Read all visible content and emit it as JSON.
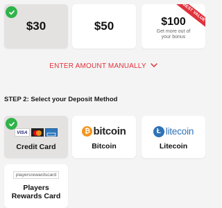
{
  "amounts": [
    {
      "label": "$30",
      "selected": true
    },
    {
      "label": "$50",
      "selected": false
    },
    {
      "label": "$100",
      "note": "Get more out of your bonus",
      "ribbon": "BEST VALUE",
      "selected": false
    }
  ],
  "enter_manually": "ENTER AMOUNT MANUALLY",
  "step2_title": "STEP 2: Select your Deposit Method",
  "methods": [
    {
      "label": "Credit Card",
      "selected": true,
      "logo_text": [
        "VISA"
      ]
    },
    {
      "label": "Bitcoin",
      "selected": false,
      "logo_text": "bitcoin"
    },
    {
      "label": "Litecoin",
      "selected": false,
      "logo_text": "litecoin"
    },
    {
      "label_line1": "Players",
      "label_line2": "Rewards Card",
      "selected": false,
      "logo_text_a": "players",
      "logo_text_b": "rewards",
      "logo_text_c": "card"
    }
  ],
  "colors": {
    "accent": "#e0323c",
    "check": "#2fb34a",
    "selected_bg": "#e4e1e1",
    "litecoin": "#2f72b8",
    "bitcoin_orange": "#f7931a"
  }
}
